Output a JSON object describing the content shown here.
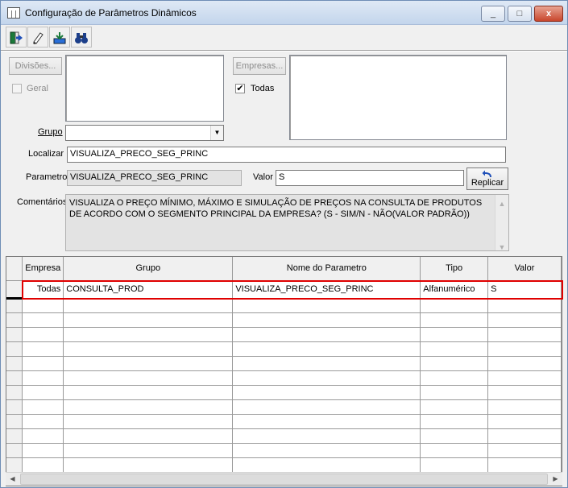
{
  "window": {
    "title": "Configuração de Parâmetros Dinâmicos",
    "controls": [
      "_",
      "□",
      "x"
    ]
  },
  "toolbar": {
    "icons": [
      "exit-icon",
      "eraser-icon",
      "save-icon",
      "binoculars-icon"
    ]
  },
  "form": {
    "divisoes_button": "Divisões...",
    "geral_label": "Geral",
    "geral_checked": false,
    "empresas_button": "Empresas...",
    "todas_label": "Todas",
    "todas_checked": true,
    "grupo_label": "Grupo",
    "grupo_value": "",
    "localizar_label": "Localizar",
    "localizar_value": "VISUALIZA_PRECO_SEG_PRINC",
    "parametro_label": "Parametro",
    "parametro_value": "VISUALIZA_PRECO_SEG_PRINC",
    "valor_label": "Valor",
    "valor_value": "S",
    "replicar_label": "Replicar",
    "comentarios_label": "Comentários",
    "comentarios_value": "VISUALIZA O PREÇO MÍNIMO, MÁXIMO E SIMULAÇÃO DE PREÇOS NA CONSULTA DE PRODUTOS DE ACORDO COM O SEGMENTO PRINCIPAL DA EMPRESA? (S - SIM/N - NÃO(VALOR PADRÃO))"
  },
  "grid": {
    "columns": [
      "Empresa",
      "Grupo",
      "Nome do Parametro",
      "Tipo",
      "Valor"
    ],
    "rows": [
      {
        "empresa": "Todas",
        "grupo": "CONSULTA_PROD",
        "nome": "VISUALIZA_PRECO_SEG_PRINC",
        "tipo": "Alfanumérico",
        "valor": "S"
      }
    ]
  },
  "colors": {
    "highlight": "#e00000",
    "titlebar": "#c3d5ec"
  }
}
